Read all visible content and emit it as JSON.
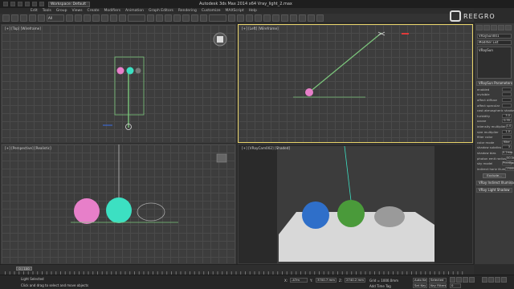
{
  "app": {
    "title": "Autodesk 3ds Max  2014 x64      Vray_light_2.max",
    "workspace": "Workspace: Default",
    "logo_text": "REEGRO"
  },
  "menu": [
    "Edit",
    "Tools",
    "Group",
    "Views",
    "Create",
    "Modifiers",
    "Animation",
    "Graph Editors",
    "Rendering",
    "Customize",
    "MAXScript",
    "Help"
  ],
  "toolbar": {
    "selection_filter": "All"
  },
  "viewports": {
    "top": "[+] [Top] [Wireframe]",
    "left": "[+] [Left] [Wireframe]",
    "perspective": "[+] [Perspective] [Realistic]",
    "camera": "[+] [VRayCam002] [Shaded]"
  },
  "command_panel": {
    "object_name": "VRaySun001",
    "modifier_list": "Modifier List",
    "stack_item": "VRaySun",
    "rollout_title": "VRaySun Parameters",
    "params": [
      {
        "label": "enabled",
        "value": ""
      },
      {
        "label": "invisible",
        "value": ""
      },
      {
        "label": "affect diffuse",
        "value": ""
      },
      {
        "label": "affect specular",
        "value": ""
      },
      {
        "label": "cast atmospheric shadows",
        "value": ""
      },
      {
        "label": "turbidity",
        "value": "3.0"
      },
      {
        "label": "ozone",
        "value": "0.35"
      },
      {
        "label": "intensity multiplier",
        "value": "1.0"
      },
      {
        "label": "size multiplier",
        "value": "1.0"
      },
      {
        "label": "filter color",
        "value": ""
      },
      {
        "label": "color mode",
        "value": "filter"
      },
      {
        "label": "shadow subdivs",
        "value": "3"
      },
      {
        "label": "shadow bias",
        "value": "0.2mm"
      },
      {
        "label": "photon emit radius",
        "value": "50.0mm"
      },
      {
        "label": "sky model",
        "value": "Preetham et"
      },
      {
        "label": "indirect horiz illum",
        "value": "25000.0"
      }
    ],
    "exclude_label": "Exclude...",
    "rollout2": "VRay Indirect Illumination",
    "rollout3": "VRay Light Shadow"
  },
  "timeline": {
    "frame": "0 / 100"
  },
  "status": {
    "selection": "Light Selected",
    "prompt": "Click and drag to select and move objects",
    "x": "-47m",
    "y": "3700.7 mm",
    "z": "2740.2 mm",
    "grid": "Grid = 1000.0mm",
    "autokey": "Auto Key",
    "selected": "Selected",
    "set_key": "Set Key",
    "key_filters": "Key Filters...",
    "add_time_tag": "Add Time Tag",
    "frame_field": "0"
  },
  "colors": {
    "light_pink": "#e77fc9",
    "light_green": "#3ce0c2",
    "teapot_gray": "#9a9a9a",
    "sphere_blue": "#2f6fc9",
    "active_border": "#e8d36a"
  }
}
